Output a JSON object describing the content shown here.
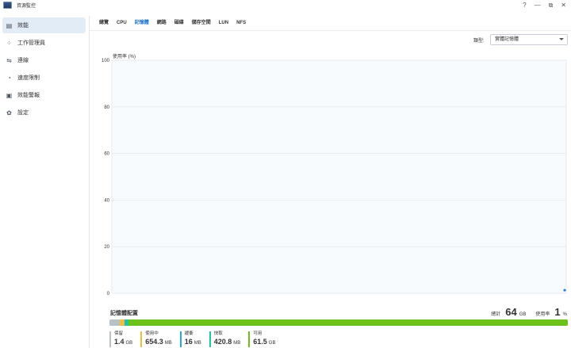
{
  "window": {
    "title": "資源監控",
    "controls": [
      "?",
      "—",
      "⧉",
      "✕"
    ]
  },
  "sidebar": {
    "items": [
      {
        "label": "效能",
        "icon": "performance-icon",
        "active": true
      },
      {
        "label": "工作管理員",
        "icon": "task-manager-icon",
        "active": false
      },
      {
        "label": "連線",
        "icon": "connection-icon",
        "active": false
      },
      {
        "label": "速度限制",
        "icon": "speed-limit-icon",
        "active": false
      },
      {
        "label": "效能警報",
        "icon": "alert-icon",
        "active": false
      },
      {
        "label": "設定",
        "icon": "gear-icon",
        "active": false
      }
    ]
  },
  "tabs": [
    {
      "label": "總覽",
      "active": false
    },
    {
      "label": "CPU",
      "active": false
    },
    {
      "label": "記憶體",
      "active": true
    },
    {
      "label": "網路",
      "active": false
    },
    {
      "label": "磁碟",
      "active": false
    },
    {
      "label": "儲存空間",
      "active": false
    },
    {
      "label": "LUN",
      "active": false
    },
    {
      "label": "NFS",
      "active": false
    }
  ],
  "filter": {
    "label": "類型:",
    "value": "實體記憶體"
  },
  "chart_data": {
    "type": "line",
    "ylabel": "使用率 (%)",
    "ylim": [
      0,
      100
    ],
    "yticks": [
      "100",
      "80",
      "60",
      "40",
      "20",
      "0"
    ],
    "series": [
      {
        "values": [
          1
        ]
      }
    ],
    "grid": true
  },
  "memory": {
    "title": "記憶體配置",
    "total_label": "總計",
    "total_value": "64",
    "total_unit": "GB",
    "usage_label": "使用率",
    "usage_value": "1",
    "usage_unit": "%",
    "segments": [
      {
        "name": "保留",
        "value": "1.4",
        "unit": "GB",
        "color": "#b8c0c8",
        "fraction": 0.022
      },
      {
        "name": "使用中",
        "value": "654.3",
        "unit": "MB",
        "color": "#f2c037",
        "fraction": 0.01
      },
      {
        "name": "緩衝",
        "value": "16",
        "unit": "MB",
        "color": "#2aa9e0",
        "fraction": 0.003
      },
      {
        "name": "快取",
        "value": "420.8",
        "unit": "MB",
        "color": "#20c4a0",
        "fraction": 0.007
      },
      {
        "name": "可用",
        "value": "61.5",
        "unit": "GB",
        "color": "#6cc21a",
        "fraction": 0.958
      }
    ]
  }
}
